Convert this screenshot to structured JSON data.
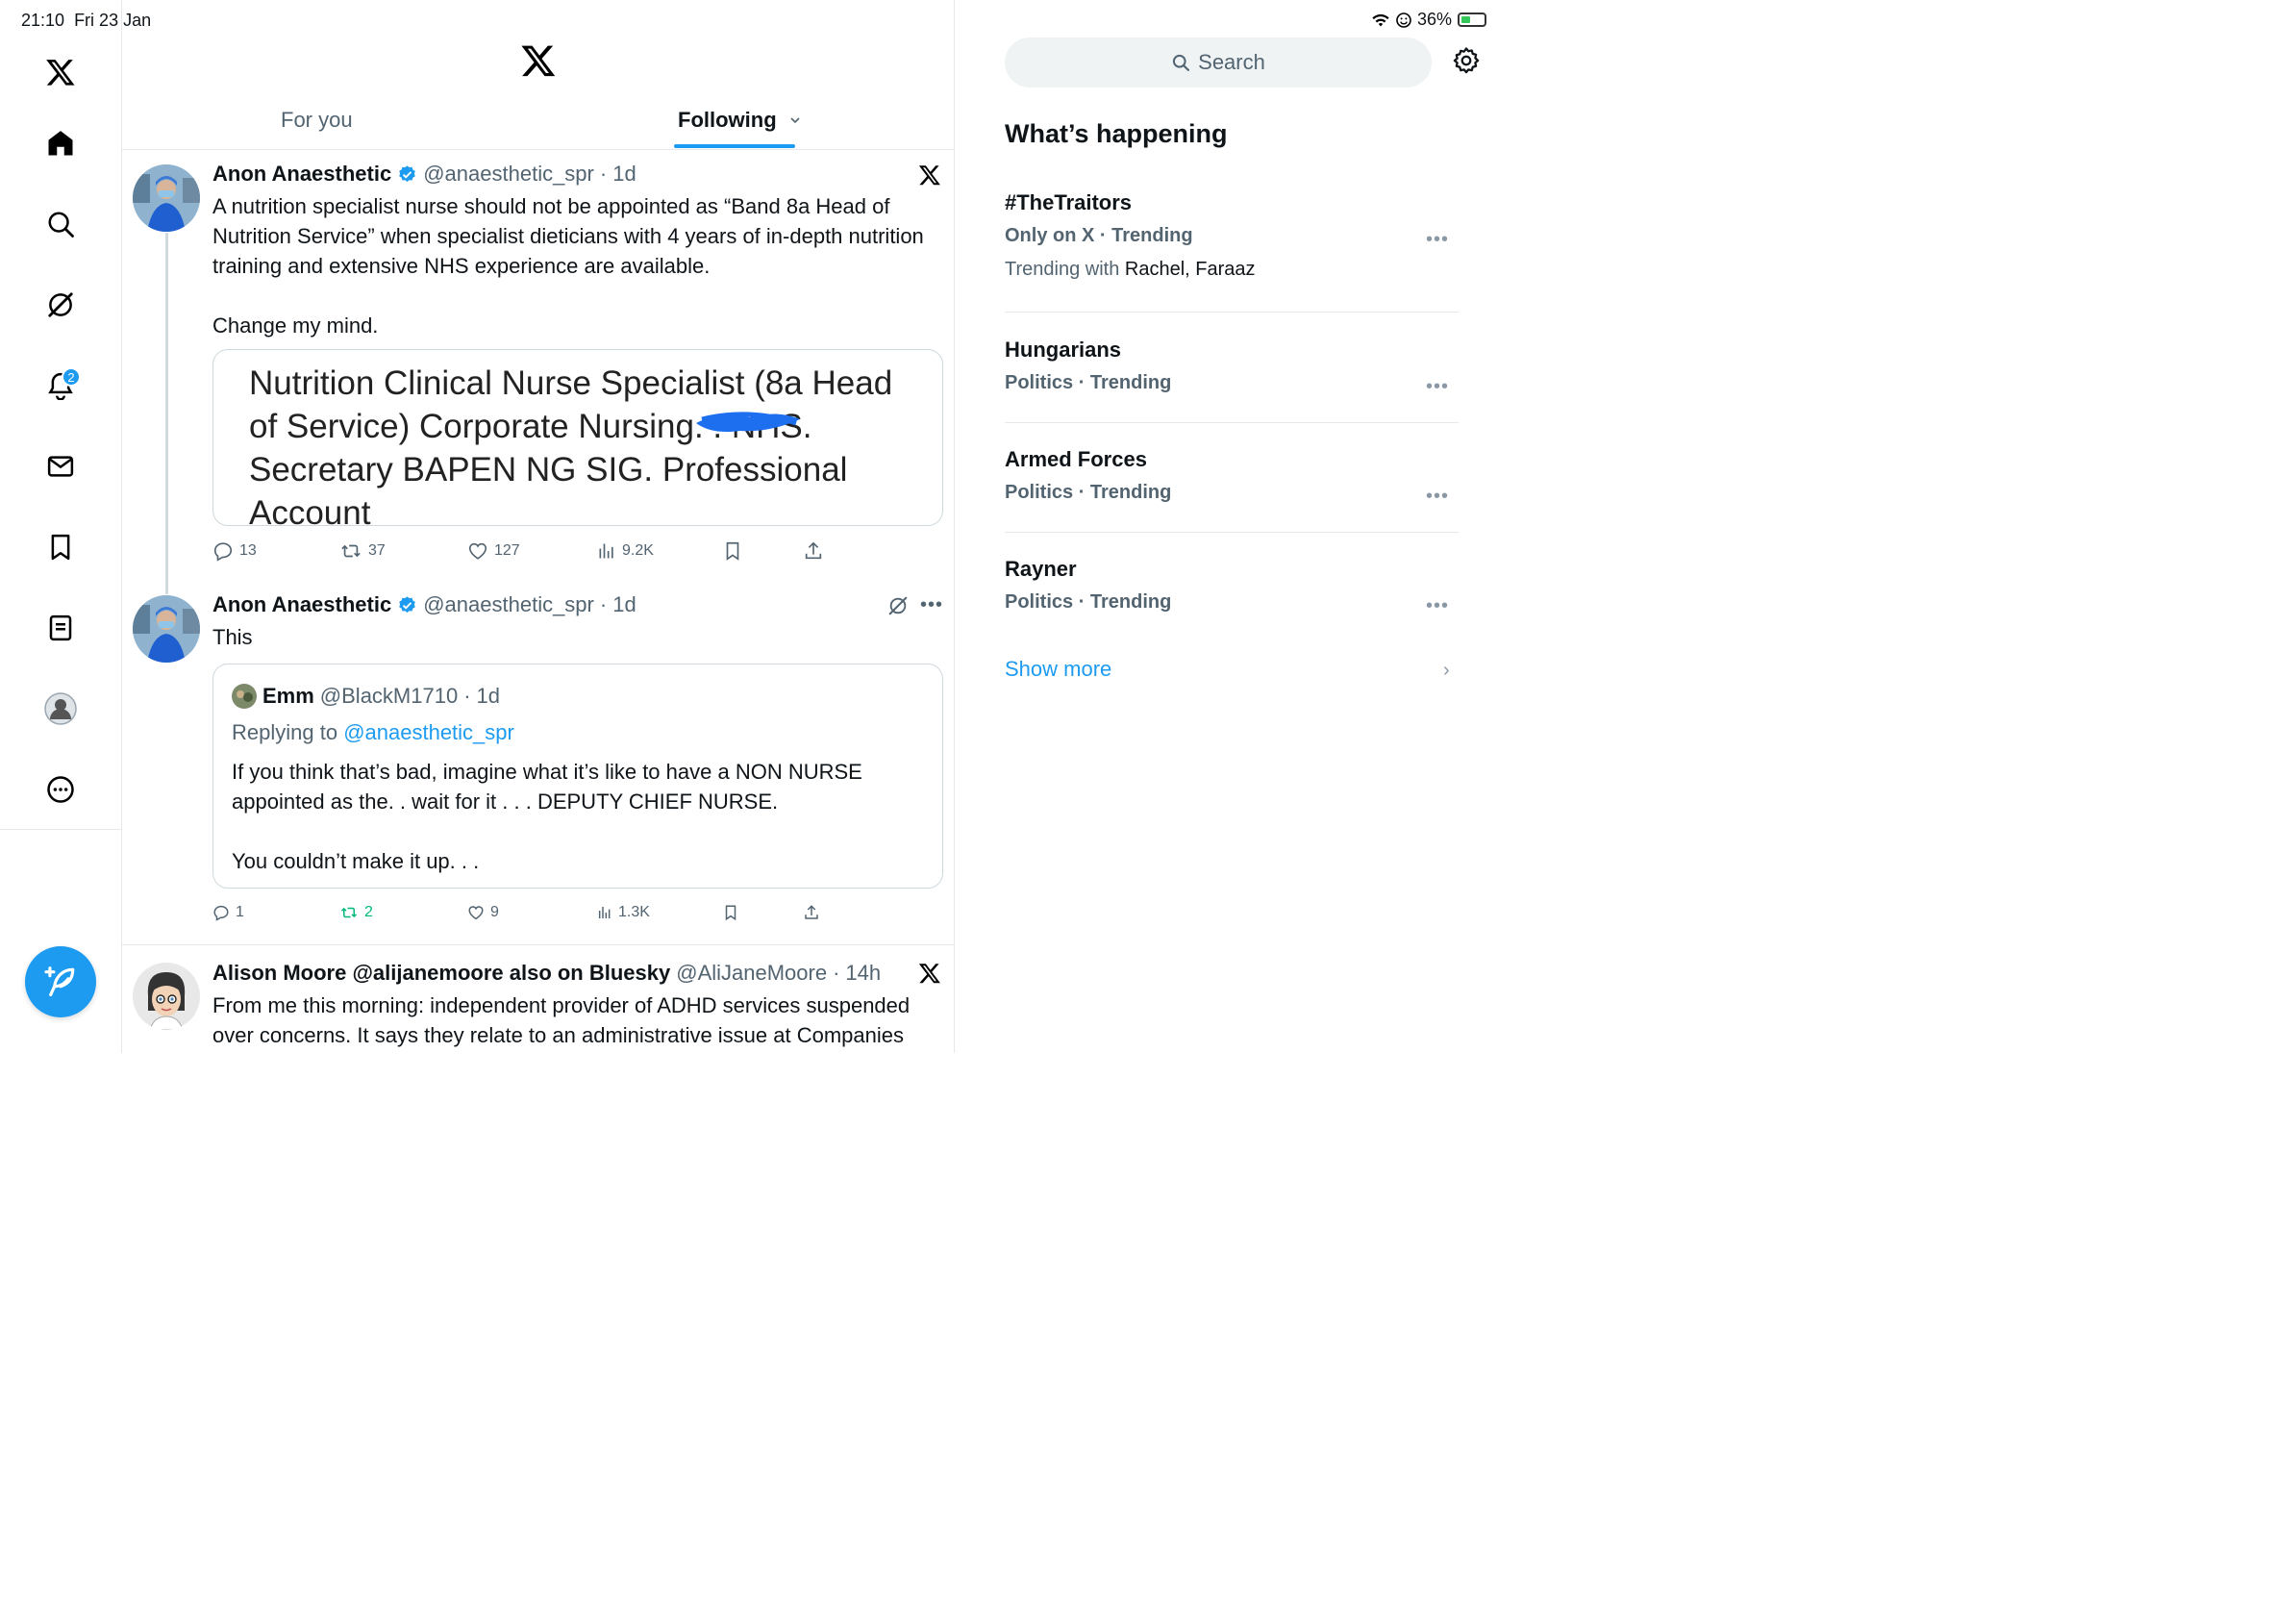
{
  "status": {
    "time": "21:10",
    "date": "Fri 23 Jan",
    "battery": "36%"
  },
  "nav": {
    "notification_count": "2"
  },
  "tabs": [
    {
      "label": "For you"
    },
    {
      "label": "Following"
    }
  ],
  "tweets": [
    {
      "name": "Anon Anaesthetic",
      "handle": "@anaesthetic_spr",
      "time": "1d",
      "text": "A nutrition specialist nurse should not be appointed as “Band 8a Head of Nutrition Service” when specialist dieticians with 4 years of in-depth nutrition training and extensive NHS experience are available.\n\nChange my mind.",
      "card_text": "Nutrition Clinical Nurse Specialist (8a Head of Service) Corporate Nursing.        . NHS. Secretary BAPEN NG SIG. Professional Account",
      "stats": {
        "replies": "13",
        "reposts": "37",
        "likes": "127",
        "views": "9.2K"
      }
    },
    {
      "name": "Anon Anaesthetic",
      "handle": "@anaesthetic_spr",
      "time": "1d",
      "text": "This",
      "quote": {
        "name": "Emm",
        "handle": "@BlackM1710",
        "time": "1d",
        "replying_prefix": "Replying to",
        "replying_handle": "@anaesthetic_spr",
        "text": "If you think that’s bad, imagine what it’s like to have a NON NURSE appointed as the. . wait for it . . . DEPUTY CHIEF NURSE.\n\nYou couldn’t make it up. . ."
      },
      "stats": {
        "replies": "1",
        "reposts": "2",
        "likes": "9",
        "views": "1.3K"
      }
    },
    {
      "name": "Alison Moore @alijanemoore also on Bluesky",
      "handle": "@AliJaneMoore",
      "time": "14h",
      "text": "From me this morning: independent provider of ADHD services suspended over concerns. It says they relate to an administrative issue at Companies"
    }
  ],
  "sidebar": {
    "search_placeholder": "Search",
    "title": "What’s happening",
    "trends": [
      {
        "name": "#TheTraitors",
        "meta": "Only on X · Trending",
        "with_prefix": "Trending with",
        "with_names": "Rachel, Faraaz"
      },
      {
        "name": "Hungarians",
        "meta": "Politics · Trending"
      },
      {
        "name": "Armed Forces",
        "meta": "Politics · Trending"
      },
      {
        "name": "Rayner",
        "meta": "Politics · Trending"
      }
    ],
    "show_more": "Show more"
  },
  "colors": {
    "accent": "#1d9bf0",
    "repost_active": "#00ba7c",
    "text_secondary": "#536471"
  }
}
